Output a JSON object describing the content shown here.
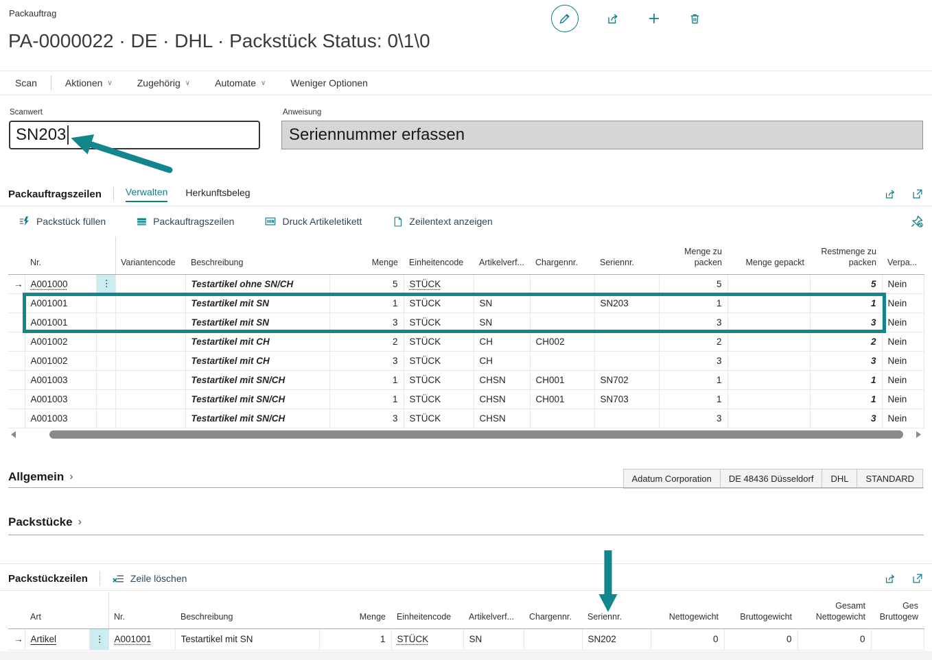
{
  "colors": {
    "accent": "#0e7d87",
    "annotation": "#12868c",
    "attention": "#c00000"
  },
  "header": {
    "caption": "Packauftrag",
    "title": "PA-0000022 · DE · DHL · Packstück Status: 0\\1\\0",
    "action_icons": [
      "edit",
      "share",
      "new",
      "delete"
    ]
  },
  "menubar": {
    "items": [
      "Scan",
      "Aktionen",
      "Zugehörig",
      "Automate",
      "Weniger Optionen"
    ]
  },
  "scan_field": {
    "label": "Scanwert",
    "value": "SN203"
  },
  "instruction_field": {
    "label": "Anweisung",
    "value": "Seriennummer erfassen"
  },
  "lines": {
    "title": "Packauftragszeilen",
    "tabs": [
      "Verwalten",
      "Herkunftsbeleg"
    ],
    "actions": [
      "Packstück füllen",
      "Packauftragszeilen",
      "Druck Artikeletikett",
      "Zeilentext anzeigen"
    ],
    "action_icons": [
      "fill-package-icon",
      "grid-icon",
      "barcode-icon",
      "document-icon"
    ],
    "corner_icons": [
      "share-icon",
      "open-in-new-icon",
      "pin-off-icon"
    ],
    "columns": [
      "Nr.",
      "Variantencode",
      "Beschreibung",
      "Menge",
      "Einheitencode",
      "Artikelverf...",
      "Chargennr.",
      "Seriennr.",
      "Menge zu packen",
      "Menge gepackt",
      "Restmenge zu packen",
      "Verpa..."
    ],
    "rows": [
      {
        "nr": "A001000",
        "variantencode": "",
        "beschreibung": "Testartikel ohne SN/CH",
        "menge": "5",
        "einheitencode": "STÜCK",
        "artikelverf": "",
        "chargennr": "",
        "seriennr": "",
        "menge_zu_packen": "5",
        "menge_gepackt": "",
        "restmenge_zu_packen": "5",
        "verpackt": "Nein"
      },
      {
        "nr": "A001001",
        "variantencode": "",
        "beschreibung": "Testartikel mit SN",
        "menge": "1",
        "einheitencode": "STÜCK",
        "artikelverf": "SN",
        "chargennr": "",
        "seriennr": "SN203",
        "menge_zu_packen": "1",
        "menge_gepackt": "",
        "restmenge_zu_packen": "1",
        "verpackt": "Nein"
      },
      {
        "nr": "A001001",
        "variantencode": "",
        "beschreibung": "Testartikel mit SN",
        "menge": "3",
        "einheitencode": "STÜCK",
        "artikelverf": "SN",
        "chargennr": "",
        "seriennr": "",
        "menge_zu_packen": "3",
        "menge_gepackt": "",
        "restmenge_zu_packen": "3",
        "verpackt": "Nein"
      },
      {
        "nr": "A001002",
        "variantencode": "",
        "beschreibung": "Testartikel mit CH",
        "menge": "2",
        "einheitencode": "STÜCK",
        "artikelverf": "CH",
        "chargennr": "CH002",
        "seriennr": "",
        "menge_zu_packen": "2",
        "menge_gepackt": "",
        "restmenge_zu_packen": "2",
        "verpackt": "Nein"
      },
      {
        "nr": "A001002",
        "variantencode": "",
        "beschreibung": "Testartikel mit CH",
        "menge": "3",
        "einheitencode": "STÜCK",
        "artikelverf": "CH",
        "chargennr": "",
        "seriennr": "",
        "menge_zu_packen": "3",
        "menge_gepackt": "",
        "restmenge_zu_packen": "3",
        "verpackt": "Nein"
      },
      {
        "nr": "A001003",
        "variantencode": "",
        "beschreibung": "Testartikel mit SN/CH",
        "menge": "1",
        "einheitencode": "STÜCK",
        "artikelverf": "CHSN",
        "chargennr": "CH001",
        "seriennr": "SN702",
        "menge_zu_packen": "1",
        "menge_gepackt": "",
        "restmenge_zu_packen": "1",
        "verpackt": "Nein"
      },
      {
        "nr": "A001003",
        "variantencode": "",
        "beschreibung": "Testartikel mit SN/CH",
        "menge": "1",
        "einheitencode": "STÜCK",
        "artikelverf": "CHSN",
        "chargennr": "CH001",
        "seriennr": "SN703",
        "menge_zu_packen": "1",
        "menge_gepackt": "",
        "restmenge_zu_packen": "1",
        "verpackt": "Nein"
      },
      {
        "nr": "A001003",
        "variantencode": "",
        "beschreibung": "Testartikel mit SN/CH",
        "menge": "3",
        "einheitencode": "STÜCK",
        "artikelverf": "CHSN",
        "chargennr": "",
        "seriennr": "",
        "menge_zu_packen": "3",
        "menge_gepackt": "",
        "restmenge_zu_packen": "3",
        "verpackt": "Nein"
      }
    ]
  },
  "allgemein": {
    "title": "Allgemein",
    "chips": [
      "Adatum Corporation",
      "DE 48436 Düsseldorf",
      "DHL",
      "STANDARD"
    ]
  },
  "packstuecke": {
    "title": "Packstücke"
  },
  "packlines": {
    "title": "Packstückzeilen",
    "actions": [
      "Zeile löschen"
    ],
    "action_icons": [
      "delete-row-icon"
    ],
    "corner_icons": [
      "share-icon",
      "open-in-new-icon"
    ],
    "columns": [
      "Art",
      "Nr.",
      "Beschreibung",
      "Menge",
      "Einheitencode",
      "Artikelverf...",
      "Chargennr.",
      "Seriennr.",
      "Nettogewicht",
      "Bruttogewicht",
      "Gesamt Nettogewicht",
      "Ges Bruttogew"
    ],
    "rows": [
      {
        "art": "Artikel",
        "nr": "A001001",
        "beschreibung": "Testartikel mit SN",
        "menge": "1",
        "einheitencode": "STÜCK",
        "artikelverf": "SN",
        "chargennr": "",
        "seriennr": "SN202",
        "nettogewicht": "0",
        "bruttogewicht": "0",
        "gesamt_nettogewicht": "0",
        "ges_bruttogewicht": ""
      }
    ]
  }
}
